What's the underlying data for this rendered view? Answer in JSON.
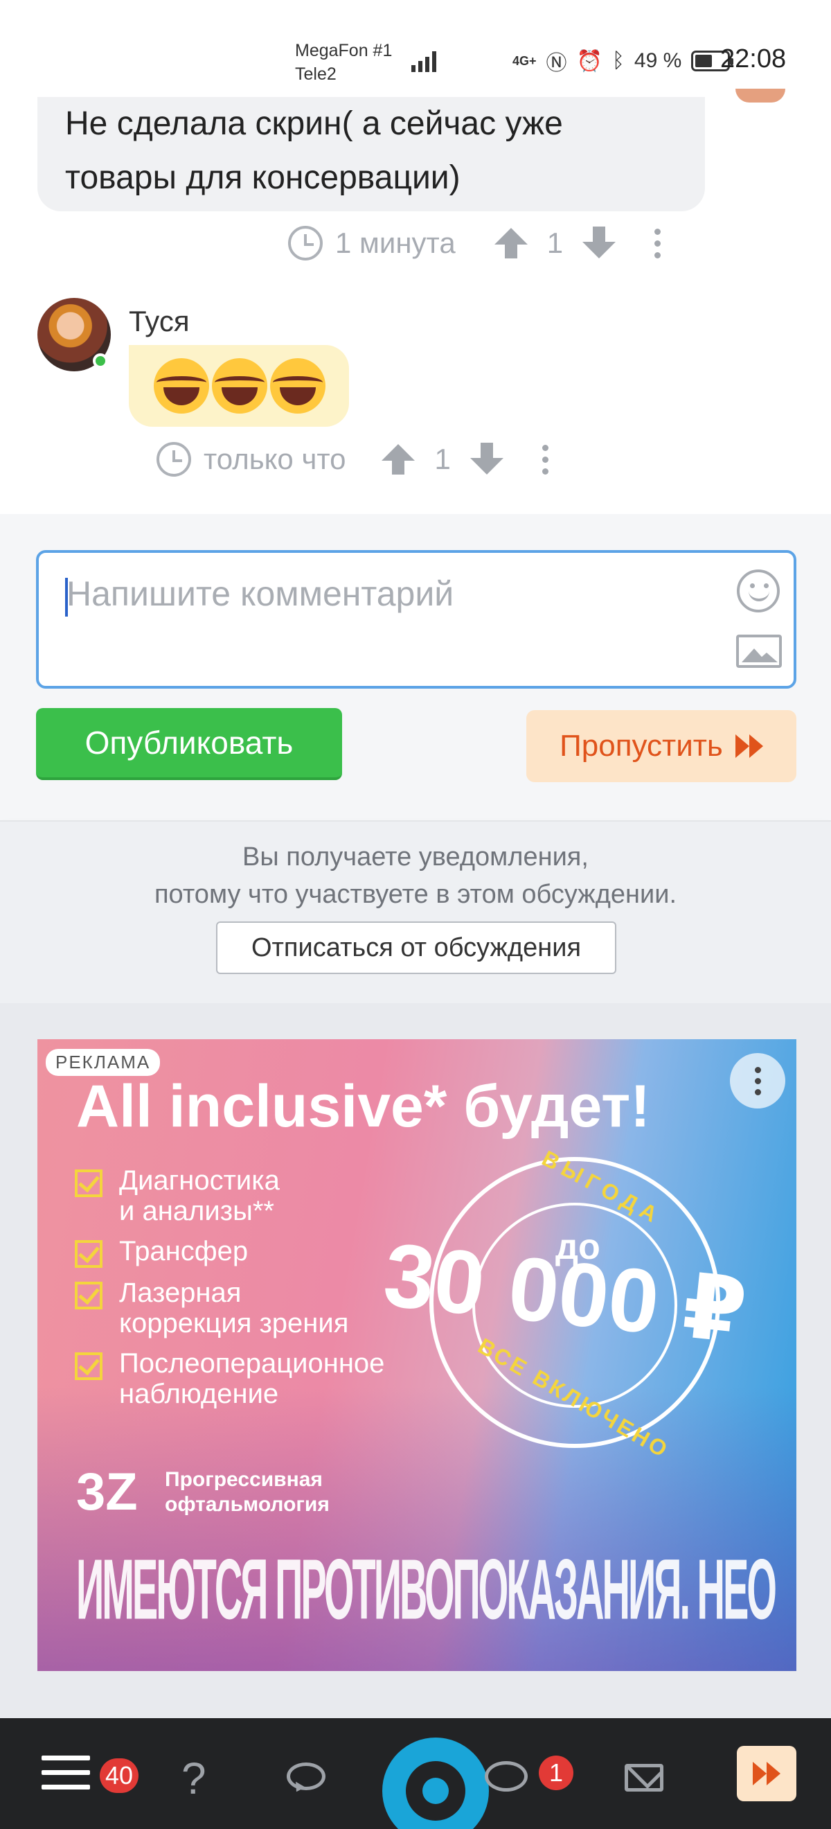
{
  "status_bar": {
    "carrier_1": "MegaFon #1",
    "carrier_2": "Tele2",
    "network": "4G+",
    "battery": "49 %",
    "time": "22:08"
  },
  "comments": [
    {
      "text": "Не сделала скрин( а сейчас уже товары для консервации)",
      "time": "1 минута",
      "votes": "1"
    },
    {
      "author": "Туся",
      "emoji": [
        "😂",
        "😂",
        "😂"
      ],
      "time": "только что",
      "votes": "1"
    }
  ],
  "reply_form": {
    "placeholder": "Напишите комментарий",
    "publish_label": "Опубликовать",
    "skip_label": "Пропустить"
  },
  "notification": {
    "line1": "Вы получаете уведомления,",
    "line2": "потому что участвуете в этом обсуждении.",
    "unsubscribe_label": "Отписаться от обсуждения"
  },
  "ad": {
    "label": "РЕКЛАМА",
    "headline": "All inclusive* будет!",
    "items": [
      "Диагностика\nи анализы**",
      "Трансфер",
      "Лазерная\nкоррекция зрения",
      "Послеоперационное\nнаблюдение"
    ],
    "badge_top": "ВЫГОДА",
    "badge_prefix": "до",
    "badge_amount": "30 000 ₽",
    "badge_bottom": "ВСЕ ВКЛЮЧЕНО",
    "logo_mark": "3Z",
    "logo_text": "Прогрессивная\nофтальмология",
    "disclaimer": "ИМЕЮТСЯ ПРОТИВОПОКАЗАНИЯ. НЕОБХОДИМА КОНСУЛЬТАЦИЯ СПЕЦИАЛИСТА"
  },
  "bottom_nav": {
    "menu_badge": "40",
    "chat_badge": "1"
  },
  "colors": {
    "publish_green": "#3bbf4b",
    "skip_bg": "#fde4c8",
    "skip_orange": "#e0531b",
    "badge_red": "#e23a36",
    "brand_blue": "#1aa5d8"
  }
}
